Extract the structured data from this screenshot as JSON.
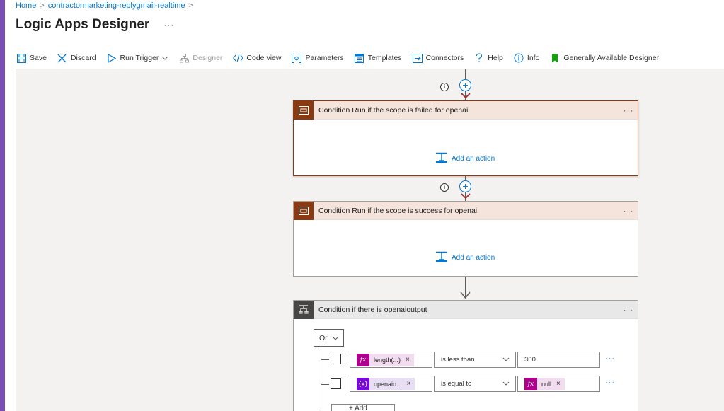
{
  "breadcrumb": {
    "home": "Home",
    "separator": ">",
    "workflow": "contractormarketing-replygmail-realtime"
  },
  "header": {
    "title": "Logic Apps Designer",
    "more": "···"
  },
  "toolbar": {
    "save": "Save",
    "discard": "Discard",
    "run_trigger": "Run Trigger",
    "designer": "Designer",
    "code_view": "Code view",
    "parameters": "Parameters",
    "templates": "Templates",
    "connectors": "Connectors",
    "help": "Help",
    "info": "Info",
    "generally_available": "Generally Available Designer"
  },
  "canvas": {
    "info_glyph": "i",
    "plus_glyph": "+",
    "card_more": "···",
    "cards": [
      {
        "title": "Condition Run if the scope is failed for openai",
        "add_action": "Add an action",
        "state": "selected"
      },
      {
        "title": "Condition Run if the scope is success for openai",
        "add_action": "Add an action"
      }
    ],
    "condition": {
      "title": "Condition if there is openaioutput",
      "group_operator": "Or",
      "row_more": "···",
      "rows": [
        {
          "left_token": "length(...)",
          "left_kind": "function",
          "left_icon": "fx",
          "operator": "is less than",
          "right_value": "300"
        },
        {
          "left_token": "openaio...",
          "left_kind": "variable",
          "left_icon": "{x}",
          "operator": "is equal to",
          "right_token": "null",
          "right_icon": "fx"
        }
      ],
      "add_label": "+ Add"
    }
  },
  "colors": {
    "accent": "#0078d4",
    "scope_header": "#f4e4dc",
    "scope_icon": "#8a3a12",
    "left_strip": "#7a4fb3"
  }
}
